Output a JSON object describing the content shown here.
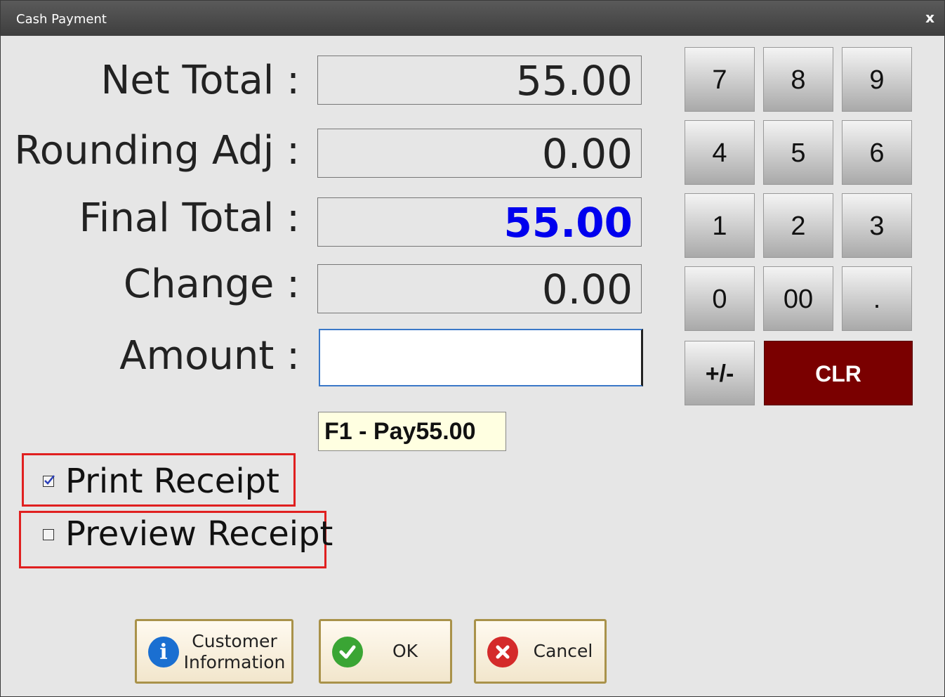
{
  "window": {
    "title": "Cash Payment",
    "close_label": "x"
  },
  "fields": {
    "net_total": {
      "label": "Net Total :",
      "value": "55.00"
    },
    "rounding_adj": {
      "label": "Rounding Adj :",
      "value": "0.00"
    },
    "final_total": {
      "label": "Final Total :",
      "value": "55.00"
    },
    "change": {
      "label": "Change :",
      "value": "0.00"
    },
    "amount": {
      "label": "Amount :",
      "value": ""
    }
  },
  "hint": "F1 - Pay55.00",
  "options": {
    "print_receipt": {
      "label": "Print Receipt",
      "checked": true
    },
    "preview_receipt": {
      "label": "Preview Receipt",
      "checked": false
    }
  },
  "keypad": {
    "k7": "7",
    "k8": "8",
    "k9": "9",
    "k4": "4",
    "k5": "5",
    "k6": "6",
    "k1": "1",
    "k2": "2",
    "k3": "3",
    "k0": "0",
    "k00": "00",
    "kdot": ".",
    "kpm": "+/-",
    "clr": "CLR"
  },
  "buttons": {
    "customer_line1": "Customer",
    "customer_line2": "Information",
    "ok": "OK",
    "cancel": "Cancel"
  },
  "colors": {
    "final_total": "#0000ee",
    "clr_button": "#7a0000",
    "highlight_box": "#e02020",
    "info_icon": "#1a6fd1",
    "ok_icon": "#3aa534",
    "cancel_icon": "#d42a2a"
  },
  "icons": {
    "customer": "info-icon",
    "ok": "checkmark-icon",
    "cancel": "x-circle-icon"
  }
}
